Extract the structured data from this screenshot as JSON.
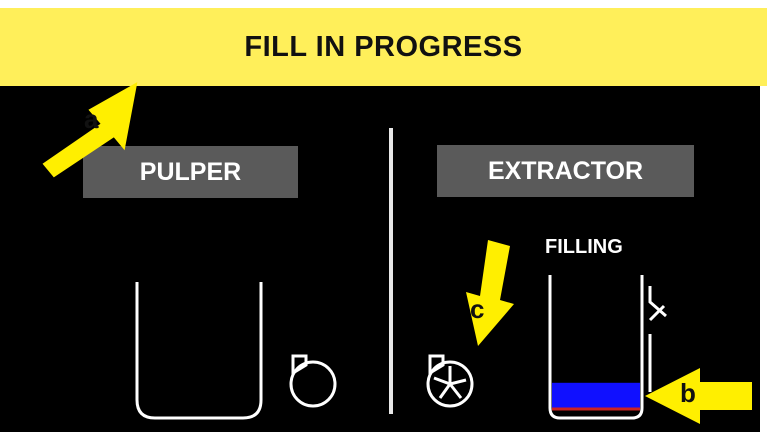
{
  "banner": {
    "title": "FILL IN PROGRESS"
  },
  "controls": {
    "pulper_label": "PULPER",
    "extractor_label": "EXTRACTOR"
  },
  "extractor": {
    "status": "FILLING",
    "fill_level": 0.2
  },
  "annotations": {
    "a": "a",
    "b": "b",
    "c": "c"
  },
  "colors": {
    "banner": "#ffef5a",
    "panel": "#000000",
    "fill": "#1010ff",
    "arrow": "#ffef00"
  }
}
